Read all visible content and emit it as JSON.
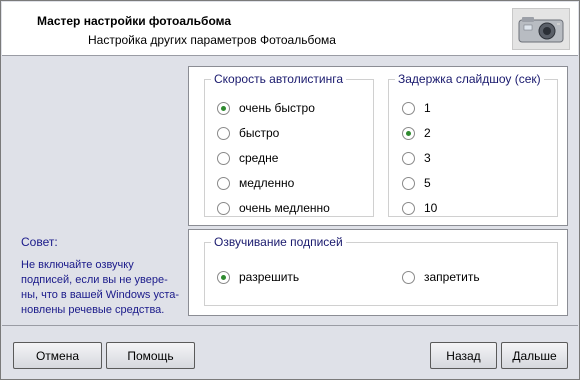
{
  "header": {
    "title": "Мастер настройки фотоальбома",
    "subtitle": "Настройка других параметров Фотоальбома",
    "image_icon": "camera-icon"
  },
  "speed_group": {
    "legend": "Скорость автолистинга",
    "options": [
      "очень быстро",
      "быстро",
      "средне",
      "медленно",
      "очень медленно"
    ],
    "selected": "очень быстро"
  },
  "delay_group": {
    "legend": "Задержка слайдшоу (сек)",
    "options": [
      "1",
      "2",
      "3",
      "5",
      "10"
    ],
    "selected": "2"
  },
  "voice_group": {
    "legend": "Озвучивание подписей",
    "options": [
      "разрешить",
      "запретить"
    ],
    "selected": "разрешить"
  },
  "tip": {
    "title": "Совет:",
    "lines": [
      "Не включайте озвучку",
      "подписей, если вы не увере-",
      "ны, что в вашей Windows уста-",
      "новлены речевые средства."
    ]
  },
  "buttons": {
    "cancel": "Отмена",
    "help": "Помощь",
    "back": "Назад",
    "next": "Дальше"
  },
  "colors": {
    "background": "#dfe1e8",
    "tip_text": "#1a1a8a",
    "legend_text": "#1a1a6e",
    "radio_check": "#2f8a2f"
  }
}
